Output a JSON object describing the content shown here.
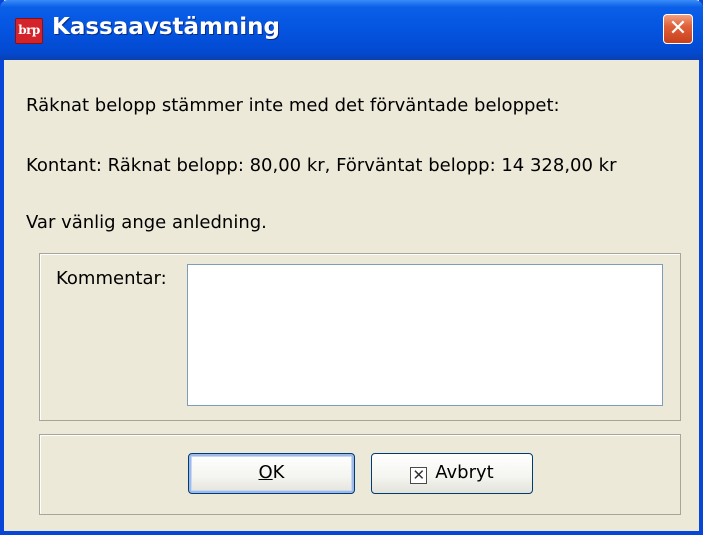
{
  "window": {
    "title": "Kassaavstämning",
    "app_icon_text": "brp",
    "close_glyph": "✕"
  },
  "message": {
    "line1": "Räknat belopp stämmer inte med det förväntade beloppet:",
    "line2": "Kontant: Räknat belopp: 80,00 kr, Förväntat belopp: 14 328,00 kr",
    "line3": "Var vänlig ange anledning."
  },
  "comment": {
    "label": "Kommentar:",
    "value": ""
  },
  "buttons": {
    "ok_mnemonic": "O",
    "ok_rest": "K",
    "cancel_label": "Avbryt",
    "cancel_icon": "✕"
  },
  "colors": {
    "titlebar": "#0454e0",
    "dialog_bg": "#ece9d8",
    "close_button": "#e0603a"
  }
}
